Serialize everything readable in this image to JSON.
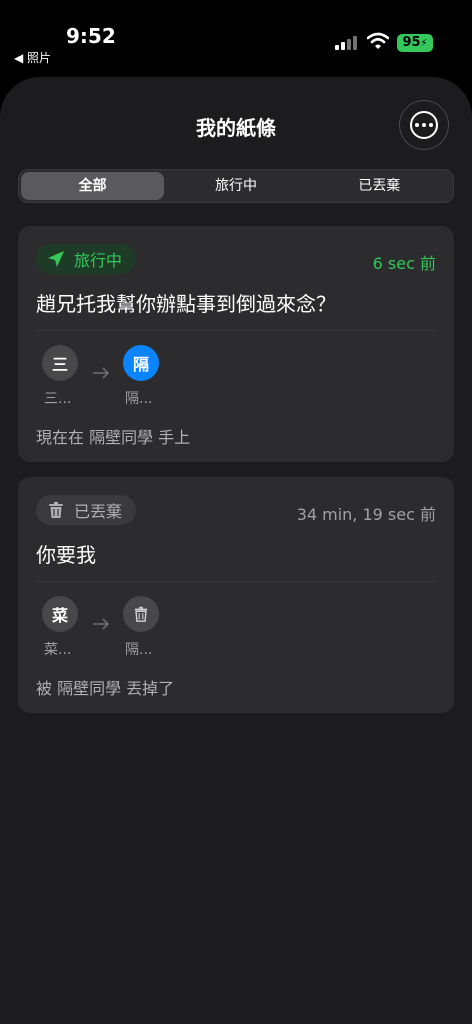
{
  "status_bar": {
    "time": "9:52",
    "back_app": "◀ 照片",
    "battery": "95"
  },
  "header": {
    "title": "我的紙條",
    "more_icon": "ellipsis-circle-icon"
  },
  "tabs": [
    {
      "label": "全部",
      "selected": true
    },
    {
      "label": "旅行中",
      "selected": false
    },
    {
      "label": "已丟棄",
      "selected": false
    }
  ],
  "notes": [
    {
      "status_label": "旅行中",
      "status_icon": "paper-plane-icon",
      "status_color": "#34c759",
      "time_ago": "6 sec 前",
      "message": "趙兄托我幫你辦點事到倒過來念？",
      "from_avatar": "三",
      "from_label": "三...",
      "to_avatar": "隔",
      "to_label": "隔...",
      "location_text": "現在在 隔壁同學 手上"
    },
    {
      "status_label": "已丟棄",
      "status_icon": "trash-icon",
      "status_color": "#8e8e93",
      "time_ago": "34 min, 19 sec 前",
      "message": "你要我",
      "from_avatar": "菜",
      "from_label": "菜...",
      "to_avatar_icon": "trash-icon",
      "to_label": "隔...",
      "location_text": "被 隔壁同學 丟掉了"
    }
  ]
}
